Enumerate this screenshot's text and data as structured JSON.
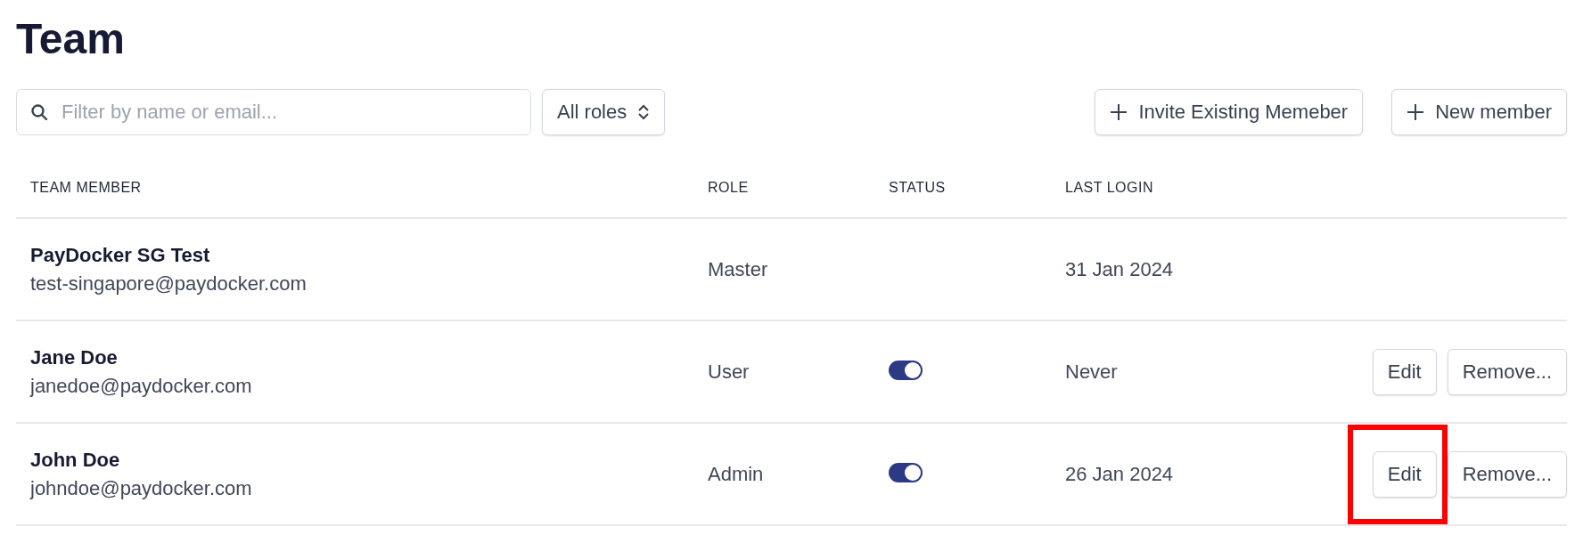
{
  "page": {
    "title": "Team"
  },
  "toolbar": {
    "search": {
      "placeholder": "Filter by name or email..."
    },
    "role_filter": "All roles",
    "buttons": [
      "Invite Existing Memeber",
      "New member"
    ]
  },
  "table": {
    "columns": [
      "TEAM MEMBER",
      "ROLE",
      "STATUS",
      "LAST LOGIN"
    ],
    "rows": [
      {
        "name": "PayDocker SG Test",
        "email": "test-singapore@paydocker.com",
        "role": "Master",
        "last_login": "31 Jan 2024"
      },
      {
        "name": "Jane Doe",
        "email": "janedoe@paydocker.com",
        "role": "User",
        "on": true,
        "last_login": "Never",
        "actions": [
          {
            "label": "Edit",
            "highlighted": false
          },
          {
            "label": "Remove...",
            "highlighted": false
          }
        ]
      },
      {
        "name": "John Doe",
        "email": "johndoe@paydocker.com",
        "role": "Admin",
        "on": true,
        "last_login": "26 Jan 2024",
        "actions": [
          {
            "label": "Edit",
            "highlighted": true
          },
          {
            "label": "Remove...",
            "highlighted": false
          }
        ]
      }
    ]
  }
}
